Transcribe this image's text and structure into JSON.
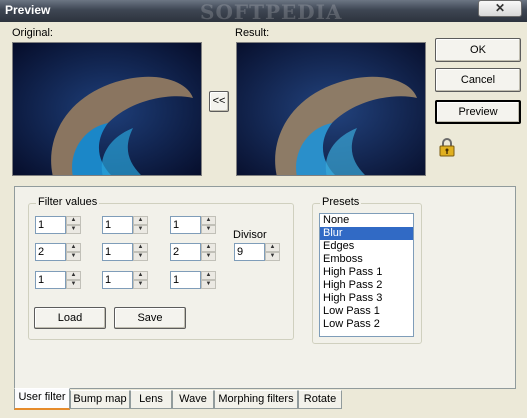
{
  "window": {
    "title": "Preview",
    "brand": "SOFTPEDIA",
    "close_symbol": "✕"
  },
  "labels": {
    "original": "Original:",
    "result": "Result:"
  },
  "buttons": {
    "ok": "OK",
    "cancel": "Cancel",
    "preview": "Preview",
    "copy_back": "<<"
  },
  "filter": {
    "group_label": "Filter values",
    "grid": [
      [
        "1",
        "1",
        "1"
      ],
      [
        "2",
        "1",
        "2"
      ],
      [
        "1",
        "1",
        "1"
      ]
    ],
    "divisor_label": "Divisor",
    "divisor_value": "9",
    "load_label": "Load",
    "save_label": "Save"
  },
  "presets": {
    "group_label": "Presets",
    "items": [
      "None",
      "Blur",
      "Edges",
      "Emboss",
      "High Pass 1",
      "High Pass 2",
      "High Pass 3",
      "Low Pass 1",
      "Low Pass 2"
    ],
    "selected": "Blur"
  },
  "tabs": [
    "User filter",
    "Bump map",
    "Lens",
    "Wave",
    "Morphing filters",
    "Rotate"
  ],
  "active_tab": "User filter",
  "colors": {
    "selection": "#316ac5",
    "tab_highlight": "#e68b2c",
    "dialog_bg": "#ece9d8"
  }
}
